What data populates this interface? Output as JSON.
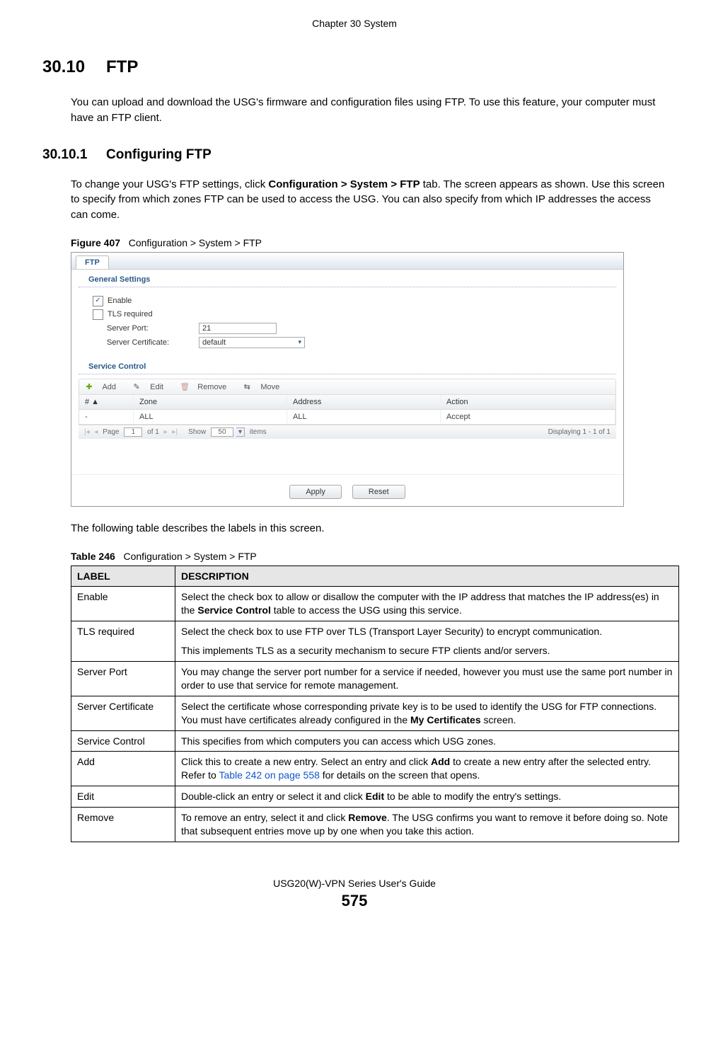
{
  "header": {
    "chapter": "Chapter 30 System"
  },
  "section": {
    "num": "30.10",
    "title": "FTP",
    "intro": "You can upload and download the USG's firmware and configuration files using FTP. To use this feature, your computer must have an FTP client."
  },
  "subsection": {
    "num": "30.10.1",
    "title": "Configuring FTP",
    "intro_prefix": "To change your USG's FTP settings, click ",
    "intro_bold": "Configuration > System > FTP",
    "intro_suffix": " tab. The screen appears as shown. Use this screen to specify from which zones FTP can be used to access the USG. You can also specify from which IP addresses the access can come."
  },
  "figure": {
    "label": "Figure 407",
    "caption": "Configuration > System > FTP"
  },
  "screenshot": {
    "tab": "FTP",
    "general_label": "General Settings",
    "enable_checked": true,
    "enable_label": "Enable",
    "tls_checked": false,
    "tls_label": "TLS required",
    "port_label": "Server Port:",
    "port_value": "21",
    "cert_label": "Server Certificate:",
    "cert_value": "default",
    "service_label": "Service Control",
    "toolbar": {
      "add": "Add",
      "edit": "Edit",
      "remove": "Remove",
      "move": "Move"
    },
    "grid": {
      "headers": {
        "num": "# ▲",
        "zone": "Zone",
        "address": "Address",
        "action": "Action"
      },
      "row": {
        "num": "-",
        "zone": "ALL",
        "address": "ALL",
        "action": "Accept"
      }
    },
    "pager": {
      "page_label": "Page",
      "page_value": "1",
      "of": "of 1",
      "show": "Show",
      "show_value": "50",
      "items": "items",
      "display": "Displaying 1 - 1 of 1"
    },
    "buttons": {
      "apply": "Apply",
      "reset": "Reset"
    }
  },
  "table_intro": "The following table describes the labels in this screen.",
  "table_caption": {
    "label": "Table 246",
    "caption": "Configuration > System > FTP"
  },
  "table": {
    "headers": {
      "label": "LABEL",
      "desc": "DESCRIPTION"
    },
    "rows": [
      {
        "label": "Enable",
        "desc_prefix": "Select the check box to allow or disallow the computer with the IP address that matches the IP address(es) in the ",
        "desc_bold": "Service Control",
        "desc_suffix": " table to access the USG using this service."
      },
      {
        "label": "TLS required",
        "desc_p1": "Select the check box to use FTP over TLS (Transport Layer Security) to encrypt communication.",
        "desc_p2": "This implements TLS as a security mechanism to secure FTP clients and/or servers."
      },
      {
        "label": "Server Port",
        "desc": "You may change the server port number for a service if needed, however you must use the same port number in order to use that service for remote management."
      },
      {
        "label": "Server Certificate",
        "desc_prefix": "Select the certificate whose corresponding private key is to be used to identify the USG for FTP connections. You must have certificates already configured in the ",
        "desc_bold": "My Certificates",
        "desc_suffix": " screen."
      },
      {
        "label": "Service Control",
        "desc": "This specifies from which computers you can access which USG zones."
      },
      {
        "label": "Add",
        "desc_prefix": "Click this to create a new entry. Select an entry and click ",
        "desc_bold": "Add",
        "desc_mid": " to create a new entry after the selected entry. Refer to ",
        "desc_link": "Table 242 on page 558",
        "desc_suffix": " for details on the screen that opens."
      },
      {
        "label": "Edit",
        "desc_prefix": "Double-click an entry or select it and click ",
        "desc_bold": "Edit",
        "desc_suffix": " to be able to modify the entry's settings."
      },
      {
        "label": "Remove",
        "desc_prefix": "To remove an entry, select it and click ",
        "desc_bold": "Remove",
        "desc_suffix": ". The USG confirms you want to remove it before doing so. Note that subsequent entries move up by one when you take this action."
      }
    ]
  },
  "footer": {
    "guide": "USG20(W)-VPN Series User's Guide",
    "page": "575"
  }
}
